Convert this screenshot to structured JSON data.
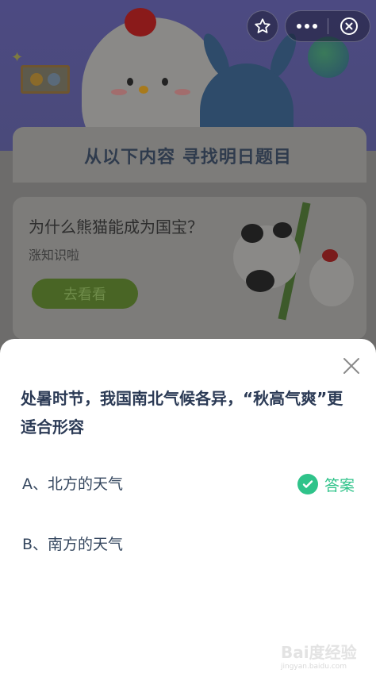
{
  "header": {
    "controls": {
      "favorite_icon": "star-icon",
      "more_icon": "more-dots-icon",
      "close_icon": "close-circle-icon"
    }
  },
  "background": {
    "banner_title": "从以下内容 寻找明日题目",
    "article": {
      "title": "为什么熊猫能成为国宝？",
      "subtitle": "涨知识啦",
      "button_label": "去看看"
    }
  },
  "quiz": {
    "close_icon": "close-x-icon",
    "question": "处暑时节，我国南北气候各异，“秋高气爽”更适合形容",
    "options": [
      {
        "label": "A、北方的天气",
        "is_answer": true
      },
      {
        "label": "B、南方的天气",
        "is_answer": false
      }
    ],
    "answer_label": "答案",
    "answer_color": "#2fc38a"
  },
  "watermark": {
    "text": "Bai度经验",
    "sub": "jingyan.baidu.com"
  }
}
